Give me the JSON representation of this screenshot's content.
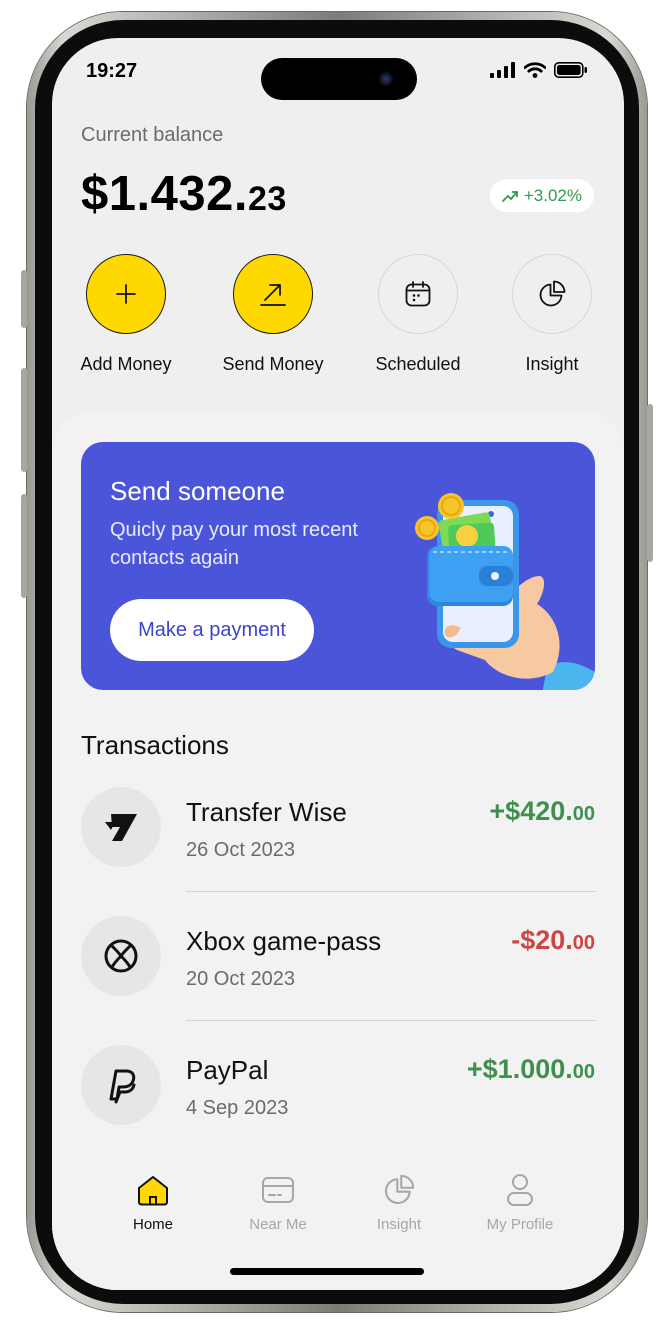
{
  "status_bar": {
    "time": "19:27"
  },
  "balance": {
    "label": "Current balance",
    "amount_major": "$1.432.",
    "amount_minor": "23",
    "change": "+3.02%"
  },
  "actions": [
    {
      "label": "Add Money",
      "icon": "plus-icon"
    },
    {
      "label": "Send Money",
      "icon": "arrow-up-right-icon"
    },
    {
      "label": "Scheduled",
      "icon": "calendar-icon"
    },
    {
      "label": "Insight",
      "icon": "pie-chart-icon"
    }
  ],
  "promo": {
    "title": "Send someone",
    "subtitle": "Quicly pay your most recent contacts again",
    "button_label": "Make a payment"
  },
  "transactions": {
    "title": "Transactions",
    "items": [
      {
        "name": "Transfer Wise",
        "date": "26 Oct 2023",
        "amount_major": "+$420.",
        "amount_minor": "00",
        "icon": "wise-logo-icon"
      },
      {
        "name": "Xbox game-pass",
        "date": "20 Oct 2023",
        "amount_major": "-$20.",
        "amount_minor": "00",
        "icon": "xbox-logo-icon"
      },
      {
        "name": "PayPal",
        "date": "4 Sep 2023",
        "amount_major": "+$1.000.",
        "amount_minor": "00",
        "icon": "paypal-logo-icon"
      }
    ]
  },
  "nav": {
    "items": [
      {
        "label": "Home",
        "icon": "home-icon"
      },
      {
        "label": "Near Me",
        "icon": "card-icon"
      },
      {
        "label": "Insight",
        "icon": "pie-chart-icon"
      },
      {
        "label": "My Profile",
        "icon": "user-icon"
      }
    ]
  },
  "colors": {
    "accent_yellow": "#ffd800",
    "promo_blue": "#4b55d9",
    "positive": "#3f8f4f",
    "negative": "#cd4545"
  }
}
